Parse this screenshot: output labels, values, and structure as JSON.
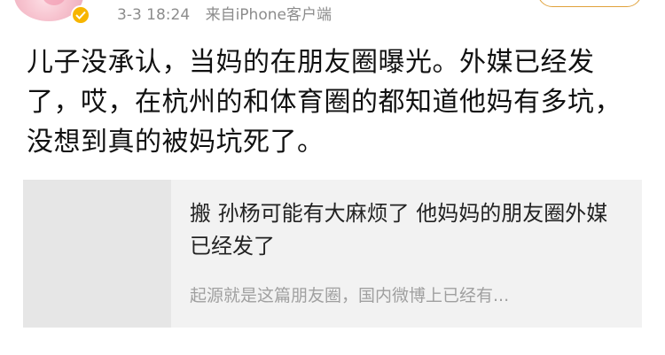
{
  "post": {
    "time": "3-3 18:24",
    "source": "来自iPhone客户端",
    "body": "儿子没承认，当妈的在朋友圈曝光。外媒已经发了，哎，在杭州的和体育圈的都知道他妈有多坑，没想到真的被妈坑死了。"
  },
  "shared_card": {
    "title": "搬 孙杨可能有大麻烦了 他妈妈的朋友圈外媒已经发了",
    "description": "起源就是这篇朋友圈，国内微博上已经有..."
  },
  "icons": {
    "verified": "verified-badge-icon"
  },
  "colors": {
    "meta_text": "#8c8c8c",
    "verified_badge": "#f7b500",
    "follow_border": "#e0a23b",
    "card_background": "#f2f2f2"
  }
}
